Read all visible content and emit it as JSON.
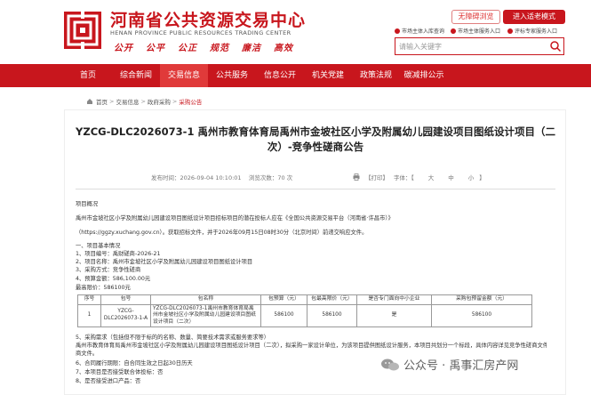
{
  "header": {
    "title": "河南省公共资源交易中心",
    "subtitle": "HENAN PROVINCE PUBLIC RESOURCES TRADING CENTER",
    "slogans": [
      "公开",
      "公平",
      "公正",
      "规范",
      "廉洁",
      "高效"
    ],
    "accessible_button": "无障碍浏览",
    "elder_button": "进入适老模式",
    "entry_links": [
      "市场主体入库查询",
      "市场主体服务入口",
      "评标专家服务入口"
    ],
    "search_placeholder": "请输入关键字"
  },
  "nav": {
    "items": [
      "首页",
      "综合新闻",
      "交易信息",
      "公共服务",
      "信息公开",
      "机关党建",
      "政策法规",
      "碳减排公示"
    ],
    "active_index": 2
  },
  "breadcrumb": [
    "首页",
    "交易信息",
    "政府采购",
    "采购公告"
  ],
  "article": {
    "title": "YZCG-DLC2026073-1 禹州市教育体育局禹州市金坡社区小学及附属幼儿园建设项目图纸设计项目（二次）-竞争性磋商公告",
    "publish_time": "发布时间：2026-09-04 10:10:01",
    "views": "浏览次数：70 次",
    "print_label": "【打印】",
    "font_label": "字体：【",
    "font_large": "大",
    "font_medium": "中",
    "font_small": "小",
    "font_close": "】",
    "para_heading": "项目概况",
    "para_1": "禹州市金坡社区小学及附属幼儿园建设项目图纸设计项目招标项目的潜在投标人应在《全国公共资源交易平台（河南省·许昌市）》",
    "para_2": "（https://ggzy.xuchang.gov.cn）。获取招标文件，并于2026年09月15日08时30分（北京时间）前递交响应文件。",
    "s1": "一、项目基本情况",
    "s2": "1、项目编号：禹财磋商-2026-21",
    "s3": "2、项目名称：禹州市金坡社区小学及附属幼儿园建设项目图纸设计项目",
    "s4": "3、采购方式：竞争性磋商",
    "s5": "4、预算金额：586,100.00元",
    "s6": "最高限价：586100元",
    "table_headers": [
      "序号",
      "包号",
      "包名称",
      "包预算（元）",
      "包最高限价（元）",
      "是否专门面向中小企业",
      "采购包预留金额（元）"
    ],
    "table_rows": [
      [
        "1",
        "YZCG-DLC2026073-1-A",
        "YZCG-DLC2026073-1禹州市教育体育局禹州市金坡社区小学及附属幼儿园建设项目图纸设计项目（二次）",
        "586100",
        "586100",
        "是",
        "586100"
      ]
    ],
    "s7": "5、采购需求（包括但不限于标的的名称、数量、简要技术需求或服务要求等）",
    "s8": "禹州市教育体育局禹州市金坡社区小学及附属幼儿园建设项目图纸设计项目（二次），拟采购一家设计单位，为该项目提供图纸设计服务，本项目共划分一个标段，具体内容详见竞争性磋商文件。",
    "s8b": "商文件。",
    "s9": "6、合同履行期限：自合同生效之日起30日历天",
    "s10": "7、本项目是否接受联合体投标：否",
    "s11": "8、是否接受进口产品：否"
  },
  "watermark": "公众号 · 禹事汇房产网",
  "colors": {
    "brand": "#c8161d",
    "nav_active": "#e03a3a"
  }
}
